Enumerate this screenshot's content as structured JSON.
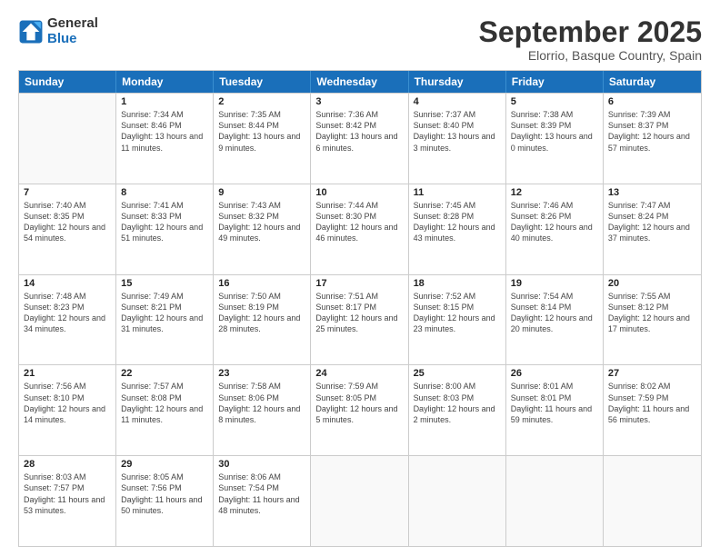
{
  "logo": {
    "general": "General",
    "blue": "Blue"
  },
  "title": "September 2025",
  "subtitle": "Elorrio, Basque Country, Spain",
  "header_days": [
    "Sunday",
    "Monday",
    "Tuesday",
    "Wednesday",
    "Thursday",
    "Friday",
    "Saturday"
  ],
  "weeks": [
    [
      {
        "day": "",
        "sunrise": "",
        "sunset": "",
        "daylight": ""
      },
      {
        "day": "1",
        "sunrise": "Sunrise: 7:34 AM",
        "sunset": "Sunset: 8:46 PM",
        "daylight": "Daylight: 13 hours and 11 minutes."
      },
      {
        "day": "2",
        "sunrise": "Sunrise: 7:35 AM",
        "sunset": "Sunset: 8:44 PM",
        "daylight": "Daylight: 13 hours and 9 minutes."
      },
      {
        "day": "3",
        "sunrise": "Sunrise: 7:36 AM",
        "sunset": "Sunset: 8:42 PM",
        "daylight": "Daylight: 13 hours and 6 minutes."
      },
      {
        "day": "4",
        "sunrise": "Sunrise: 7:37 AM",
        "sunset": "Sunset: 8:40 PM",
        "daylight": "Daylight: 13 hours and 3 minutes."
      },
      {
        "day": "5",
        "sunrise": "Sunrise: 7:38 AM",
        "sunset": "Sunset: 8:39 PM",
        "daylight": "Daylight: 13 hours and 0 minutes."
      },
      {
        "day": "6",
        "sunrise": "Sunrise: 7:39 AM",
        "sunset": "Sunset: 8:37 PM",
        "daylight": "Daylight: 12 hours and 57 minutes."
      }
    ],
    [
      {
        "day": "7",
        "sunrise": "Sunrise: 7:40 AM",
        "sunset": "Sunset: 8:35 PM",
        "daylight": "Daylight: 12 hours and 54 minutes."
      },
      {
        "day": "8",
        "sunrise": "Sunrise: 7:41 AM",
        "sunset": "Sunset: 8:33 PM",
        "daylight": "Daylight: 12 hours and 51 minutes."
      },
      {
        "day": "9",
        "sunrise": "Sunrise: 7:43 AM",
        "sunset": "Sunset: 8:32 PM",
        "daylight": "Daylight: 12 hours and 49 minutes."
      },
      {
        "day": "10",
        "sunrise": "Sunrise: 7:44 AM",
        "sunset": "Sunset: 8:30 PM",
        "daylight": "Daylight: 12 hours and 46 minutes."
      },
      {
        "day": "11",
        "sunrise": "Sunrise: 7:45 AM",
        "sunset": "Sunset: 8:28 PM",
        "daylight": "Daylight: 12 hours and 43 minutes."
      },
      {
        "day": "12",
        "sunrise": "Sunrise: 7:46 AM",
        "sunset": "Sunset: 8:26 PM",
        "daylight": "Daylight: 12 hours and 40 minutes."
      },
      {
        "day": "13",
        "sunrise": "Sunrise: 7:47 AM",
        "sunset": "Sunset: 8:24 PM",
        "daylight": "Daylight: 12 hours and 37 minutes."
      }
    ],
    [
      {
        "day": "14",
        "sunrise": "Sunrise: 7:48 AM",
        "sunset": "Sunset: 8:23 PM",
        "daylight": "Daylight: 12 hours and 34 minutes."
      },
      {
        "day": "15",
        "sunrise": "Sunrise: 7:49 AM",
        "sunset": "Sunset: 8:21 PM",
        "daylight": "Daylight: 12 hours and 31 minutes."
      },
      {
        "day": "16",
        "sunrise": "Sunrise: 7:50 AM",
        "sunset": "Sunset: 8:19 PM",
        "daylight": "Daylight: 12 hours and 28 minutes."
      },
      {
        "day": "17",
        "sunrise": "Sunrise: 7:51 AM",
        "sunset": "Sunset: 8:17 PM",
        "daylight": "Daylight: 12 hours and 25 minutes."
      },
      {
        "day": "18",
        "sunrise": "Sunrise: 7:52 AM",
        "sunset": "Sunset: 8:15 PM",
        "daylight": "Daylight: 12 hours and 23 minutes."
      },
      {
        "day": "19",
        "sunrise": "Sunrise: 7:54 AM",
        "sunset": "Sunset: 8:14 PM",
        "daylight": "Daylight: 12 hours and 20 minutes."
      },
      {
        "day": "20",
        "sunrise": "Sunrise: 7:55 AM",
        "sunset": "Sunset: 8:12 PM",
        "daylight": "Daylight: 12 hours and 17 minutes."
      }
    ],
    [
      {
        "day": "21",
        "sunrise": "Sunrise: 7:56 AM",
        "sunset": "Sunset: 8:10 PM",
        "daylight": "Daylight: 12 hours and 14 minutes."
      },
      {
        "day": "22",
        "sunrise": "Sunrise: 7:57 AM",
        "sunset": "Sunset: 8:08 PM",
        "daylight": "Daylight: 12 hours and 11 minutes."
      },
      {
        "day": "23",
        "sunrise": "Sunrise: 7:58 AM",
        "sunset": "Sunset: 8:06 PM",
        "daylight": "Daylight: 12 hours and 8 minutes."
      },
      {
        "day": "24",
        "sunrise": "Sunrise: 7:59 AM",
        "sunset": "Sunset: 8:05 PM",
        "daylight": "Daylight: 12 hours and 5 minutes."
      },
      {
        "day": "25",
        "sunrise": "Sunrise: 8:00 AM",
        "sunset": "Sunset: 8:03 PM",
        "daylight": "Daylight: 12 hours and 2 minutes."
      },
      {
        "day": "26",
        "sunrise": "Sunrise: 8:01 AM",
        "sunset": "Sunset: 8:01 PM",
        "daylight": "Daylight: 11 hours and 59 minutes."
      },
      {
        "day": "27",
        "sunrise": "Sunrise: 8:02 AM",
        "sunset": "Sunset: 7:59 PM",
        "daylight": "Daylight: 11 hours and 56 minutes."
      }
    ],
    [
      {
        "day": "28",
        "sunrise": "Sunrise: 8:03 AM",
        "sunset": "Sunset: 7:57 PM",
        "daylight": "Daylight: 11 hours and 53 minutes."
      },
      {
        "day": "29",
        "sunrise": "Sunrise: 8:05 AM",
        "sunset": "Sunset: 7:56 PM",
        "daylight": "Daylight: 11 hours and 50 minutes."
      },
      {
        "day": "30",
        "sunrise": "Sunrise: 8:06 AM",
        "sunset": "Sunset: 7:54 PM",
        "daylight": "Daylight: 11 hours and 48 minutes."
      },
      {
        "day": "",
        "sunrise": "",
        "sunset": "",
        "daylight": ""
      },
      {
        "day": "",
        "sunrise": "",
        "sunset": "",
        "daylight": ""
      },
      {
        "day": "",
        "sunrise": "",
        "sunset": "",
        "daylight": ""
      },
      {
        "day": "",
        "sunrise": "",
        "sunset": "",
        "daylight": ""
      }
    ]
  ]
}
